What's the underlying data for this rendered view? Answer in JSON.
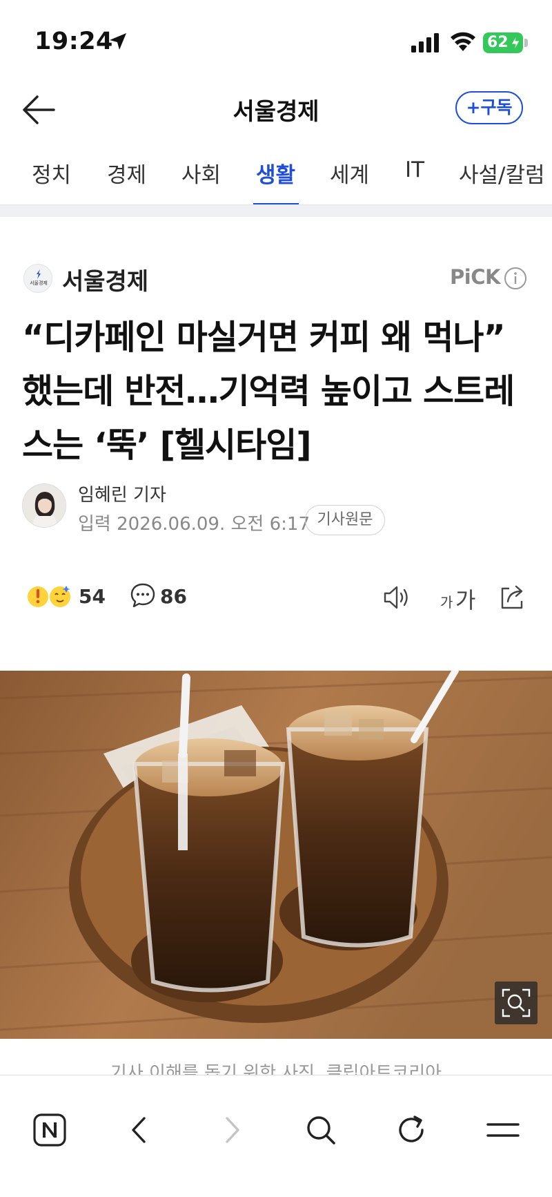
{
  "status_bar": {
    "time": "19:24",
    "battery_level": "62",
    "icons": [
      "location-arrow-icon",
      "cellular-signal-icon",
      "wifi-icon",
      "battery-charging-icon"
    ]
  },
  "header": {
    "title": "서울경제",
    "subscribe_label": "+구독"
  },
  "tabs": [
    {
      "label": "정치",
      "active": false
    },
    {
      "label": "경제",
      "active": false
    },
    {
      "label": "사회",
      "active": false
    },
    {
      "label": "생활",
      "active": true
    },
    {
      "label": "세계",
      "active": false
    },
    {
      "label": "IT",
      "active": false
    },
    {
      "label": "사설/칼럼",
      "active": false
    }
  ],
  "article": {
    "press_name": "서울경제",
    "press_logo_text": "서울경제",
    "pick_label": "PiCK",
    "headline": "“디카페인 마실거면 커피 왜 먹나” 했는데 반전…기억력 높이고 스트레스는 ‘뚝’ [헬시타임]",
    "reporter": "임혜린 기자",
    "date": "입력 2026.06.09. 오전 6:17",
    "original_label": "기사원문",
    "reaction_count": "54",
    "comment_count": "86",
    "font_size_small": "가",
    "font_size_big": "가",
    "caption": "기사 이해를 돕기 위한 사진. 클립아트코리아"
  },
  "colors": {
    "accent": "#1f4fd6",
    "battery": "#34c759",
    "muted": "#888888"
  }
}
